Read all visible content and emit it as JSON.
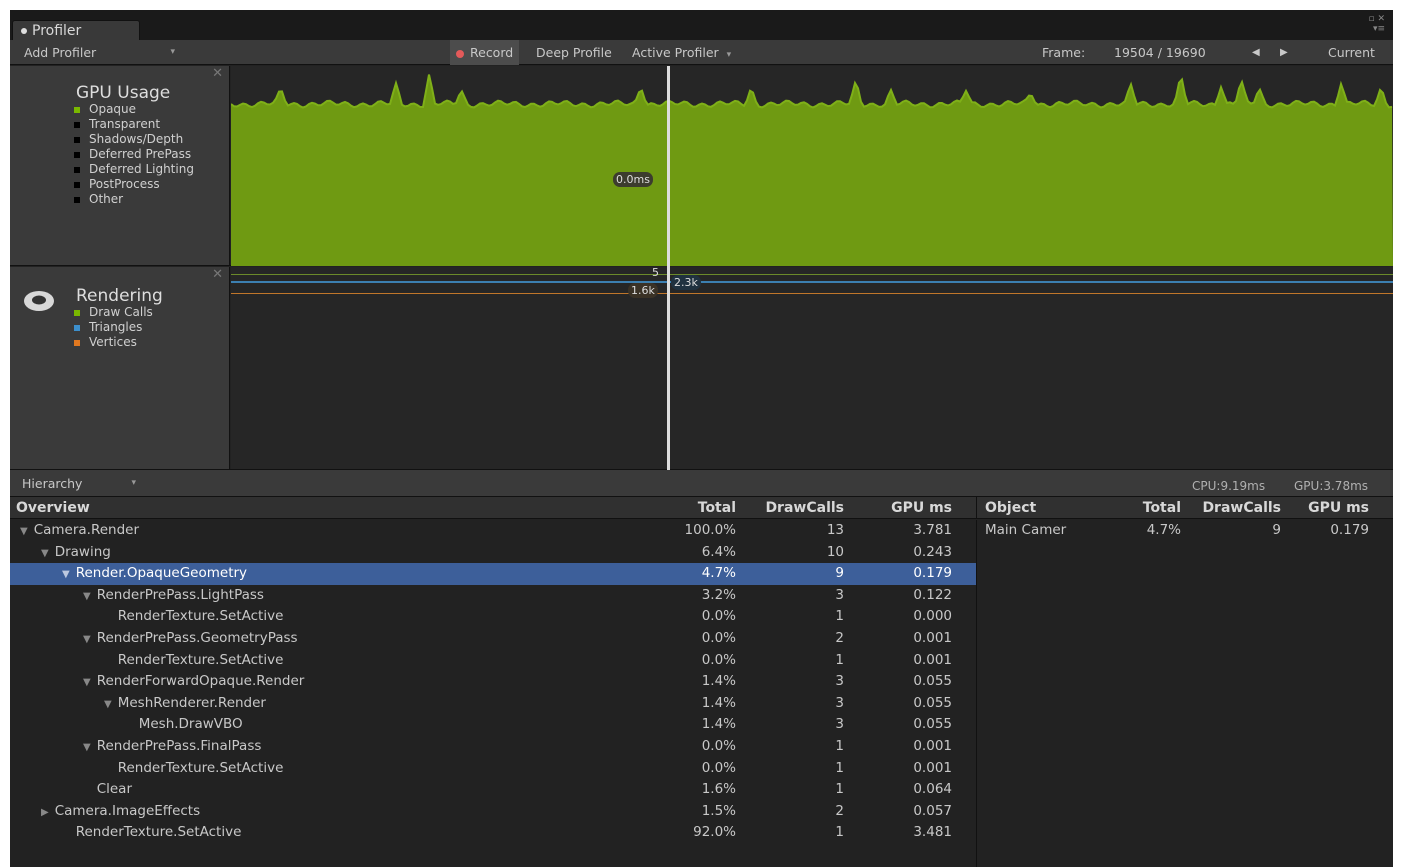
{
  "window": {
    "tab_title": "Profiler"
  },
  "toolbar": {
    "add_profiler": "Add Profiler",
    "record": "Record",
    "deep_profile": "Deep Profile",
    "active_profiler": "Active Profiler",
    "frame_label": "Frame:",
    "frame_value": "19504 / 19690",
    "current": "Current"
  },
  "gpu_module": {
    "title": "GPU Usage",
    "legend": [
      {
        "label": "Opaque",
        "color": "#7ab800"
      },
      {
        "label": "Transparent",
        "color": "#000000"
      },
      {
        "label": "Shadows/Depth",
        "color": "#000000"
      },
      {
        "label": "Deferred PrePass",
        "color": "#000000"
      },
      {
        "label": "Deferred Lighting",
        "color": "#000000"
      },
      {
        "label": "PostProcess",
        "color": "#000000"
      },
      {
        "label": "Other",
        "color": "#000000"
      }
    ],
    "cursor_value": "0.0ms",
    "graph_color": "#6f9a12"
  },
  "rendering_module": {
    "title": "Rendering",
    "legend": [
      {
        "label": "Draw Calls",
        "color": "#7ab800"
      },
      {
        "label": "Triangles",
        "color": "#3c8fcc"
      },
      {
        "label": "Vertices",
        "color": "#e07820"
      }
    ],
    "readout_draw_calls": "5",
    "readout_vertices": "1.6k",
    "readout_triangles": "2.3k"
  },
  "hierarchy": {
    "view_label": "Hierarchy",
    "cpu_time": "CPU:9.19ms",
    "gpu_time": "GPU:3.78ms",
    "columns": {
      "overview": "Overview",
      "total": "Total",
      "drawcalls": "DrawCalls",
      "gpums": "GPU ms"
    },
    "rows": [
      {
        "name": "Camera.Render",
        "indent": 0,
        "expander": "open",
        "total": "100.0%",
        "drawcalls": "13",
        "gpums": "3.781"
      },
      {
        "name": "Drawing",
        "indent": 1,
        "expander": "open",
        "total": "6.4%",
        "drawcalls": "10",
        "gpums": "0.243"
      },
      {
        "name": "Render.OpaqueGeometry",
        "indent": 2,
        "expander": "open",
        "total": "4.7%",
        "drawcalls": "9",
        "gpums": "0.179",
        "selected": true
      },
      {
        "name": "RenderPrePass.LightPass",
        "indent": 3,
        "expander": "open",
        "total": "3.2%",
        "drawcalls": "3",
        "gpums": "0.122"
      },
      {
        "name": "RenderTexture.SetActive",
        "indent": 4,
        "expander": "none",
        "total": "0.0%",
        "drawcalls": "1",
        "gpums": "0.000"
      },
      {
        "name": "RenderPrePass.GeometryPass",
        "indent": 3,
        "expander": "open",
        "total": "0.0%",
        "drawcalls": "2",
        "gpums": "0.001"
      },
      {
        "name": "RenderTexture.SetActive",
        "indent": 4,
        "expander": "none",
        "total": "0.0%",
        "drawcalls": "1",
        "gpums": "0.001"
      },
      {
        "name": "RenderForwardOpaque.Render",
        "indent": 3,
        "expander": "open",
        "total": "1.4%",
        "drawcalls": "3",
        "gpums": "0.055"
      },
      {
        "name": "MeshRenderer.Render",
        "indent": 4,
        "expander": "open",
        "total": "1.4%",
        "drawcalls": "3",
        "gpums": "0.055"
      },
      {
        "name": "Mesh.DrawVBO",
        "indent": 5,
        "expander": "none",
        "total": "1.4%",
        "drawcalls": "3",
        "gpums": "0.055"
      },
      {
        "name": "RenderPrePass.FinalPass",
        "indent": 3,
        "expander": "open",
        "total": "0.0%",
        "drawcalls": "1",
        "gpums": "0.001"
      },
      {
        "name": "RenderTexture.SetActive",
        "indent": 4,
        "expander": "none",
        "total": "0.0%",
        "drawcalls": "1",
        "gpums": "0.001"
      },
      {
        "name": "Clear",
        "indent": 3,
        "expander": "none",
        "total": "1.6%",
        "drawcalls": "1",
        "gpums": "0.064"
      },
      {
        "name": "Camera.ImageEffects",
        "indent": 1,
        "expander": "closed",
        "total": "1.5%",
        "drawcalls": "2",
        "gpums": "0.057"
      },
      {
        "name": "RenderTexture.SetActive",
        "indent": 2,
        "expander": "none",
        "total": "92.0%",
        "drawcalls": "1",
        "gpums": "3.481"
      }
    ]
  },
  "object_panel": {
    "columns": {
      "object": "Object",
      "total": "Total",
      "drawcalls": "DrawCalls",
      "gpums": "GPU ms"
    },
    "rows": [
      {
        "object": "Main Camer",
        "total": "4.7%",
        "drawcalls": "9",
        "gpums": "0.179"
      }
    ]
  }
}
